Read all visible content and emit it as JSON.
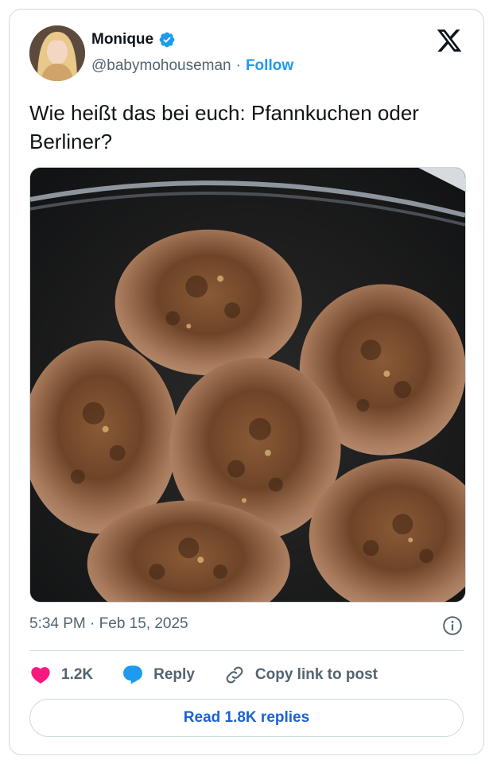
{
  "author": {
    "name": "Monique",
    "handle": "@babymohouseman",
    "separator": "·",
    "follow_label": "Follow",
    "verified": true
  },
  "tweet": {
    "text": "Wie heißt das bei euch: Pfannkuchen oder Berliner?",
    "timestamp": "5:34 PM · Feb 15, 2025"
  },
  "actions": {
    "likes": "1.2K",
    "reply_label": "Reply",
    "copy_label": "Copy link to post"
  },
  "replies_button": "Read 1.8K replies",
  "colors": {
    "accent": "#1d9bf0",
    "like": "#f91880",
    "link": "#1d62d1",
    "muted": "#536471",
    "border": "#cfd9de"
  },
  "icons": [
    "verified-badge-icon",
    "x-logo-icon",
    "info-icon",
    "heart-icon",
    "reply-bubble-icon",
    "link-icon"
  ]
}
